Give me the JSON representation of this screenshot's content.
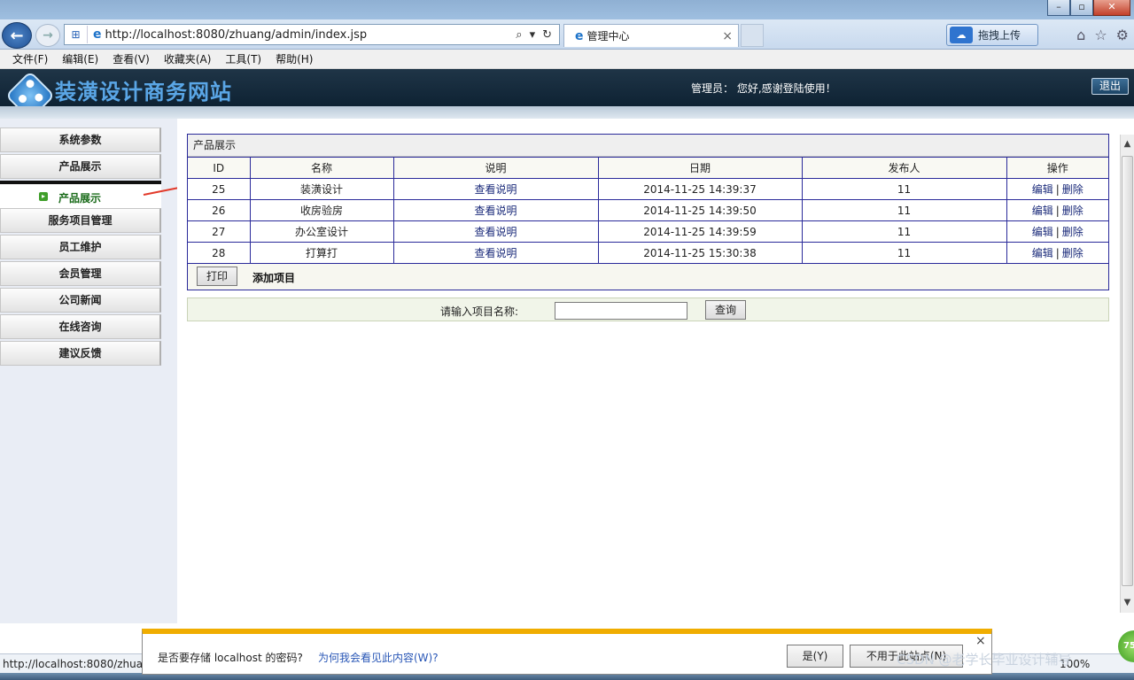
{
  "browser": {
    "url": "http://localhost:8080/zhuang/admin/index.jsp",
    "tab_title": "管理中心",
    "tab_close": "×",
    "upload_label": "拖拽上传",
    "window_controls": [
      "–",
      "▫",
      "✕"
    ]
  },
  "menu": [
    "文件(F)",
    "编辑(E)",
    "查看(V)",
    "收藏夹(A)",
    "工具(T)",
    "帮助(H)"
  ],
  "header": {
    "site_title": "装潢设计商务网站",
    "greeting": "管理员： 您好,感谢登陆使用！",
    "logout_label": "退出"
  },
  "sidebar": {
    "items": [
      "系统参数",
      "产品展示",
      "服务项目管理",
      "员工维护",
      "会员管理",
      "公司新闻",
      "在线咨询",
      "建议反馈"
    ],
    "sub_item": "产品展示"
  },
  "panel": {
    "title": "产品展示",
    "columns": [
      "ID",
      "名称",
      "说明",
      "日期",
      "发布人",
      "操作"
    ],
    "rows": [
      {
        "id": "25",
        "name": "装潢设计",
        "desc": "查看说明",
        "date": "2014-11-25 14:39:37",
        "publisher": "11",
        "edit": "编辑",
        "sep": "|",
        "delete": "删除"
      },
      {
        "id": "26",
        "name": "收房验房",
        "desc": "查看说明",
        "date": "2014-11-25 14:39:50",
        "publisher": "11",
        "edit": "编辑",
        "sep": "|",
        "delete": "删除"
      },
      {
        "id": "27",
        "name": "办公室设计",
        "desc": "查看说明",
        "date": "2014-11-25 14:39:59",
        "publisher": "11",
        "edit": "编辑",
        "sep": "|",
        "delete": "删除"
      },
      {
        "id": "28",
        "name": "打算打",
        "desc": "查看说明",
        "date": "2014-11-25 15:30:38",
        "publisher": "11",
        "edit": "编辑",
        "sep": "|",
        "delete": "删除"
      }
    ],
    "print_label": "打印",
    "add_label": "添加项目"
  },
  "search": {
    "label": "请输入项目名称:",
    "value": "",
    "button": "查询"
  },
  "status": {
    "url": "http://localhost:8080/zhuan",
    "zoom": "100%"
  },
  "notification": {
    "text": "是否要存储 localhost 的密码?",
    "link": "为何我会看见此内容(W)?",
    "yes": "是(Y)",
    "no": "不用于此站点(N)",
    "close": "×"
  },
  "badge": "75",
  "watermark": "CSDN @老学长毕业设计辅导",
  "colors": {
    "header_bg": "#0e2233",
    "title_blue": "#5aa6e6",
    "grid_border": "#2a2a9a",
    "active_sub": "#1a6b1a",
    "notify_bar": "#f0ad00"
  }
}
